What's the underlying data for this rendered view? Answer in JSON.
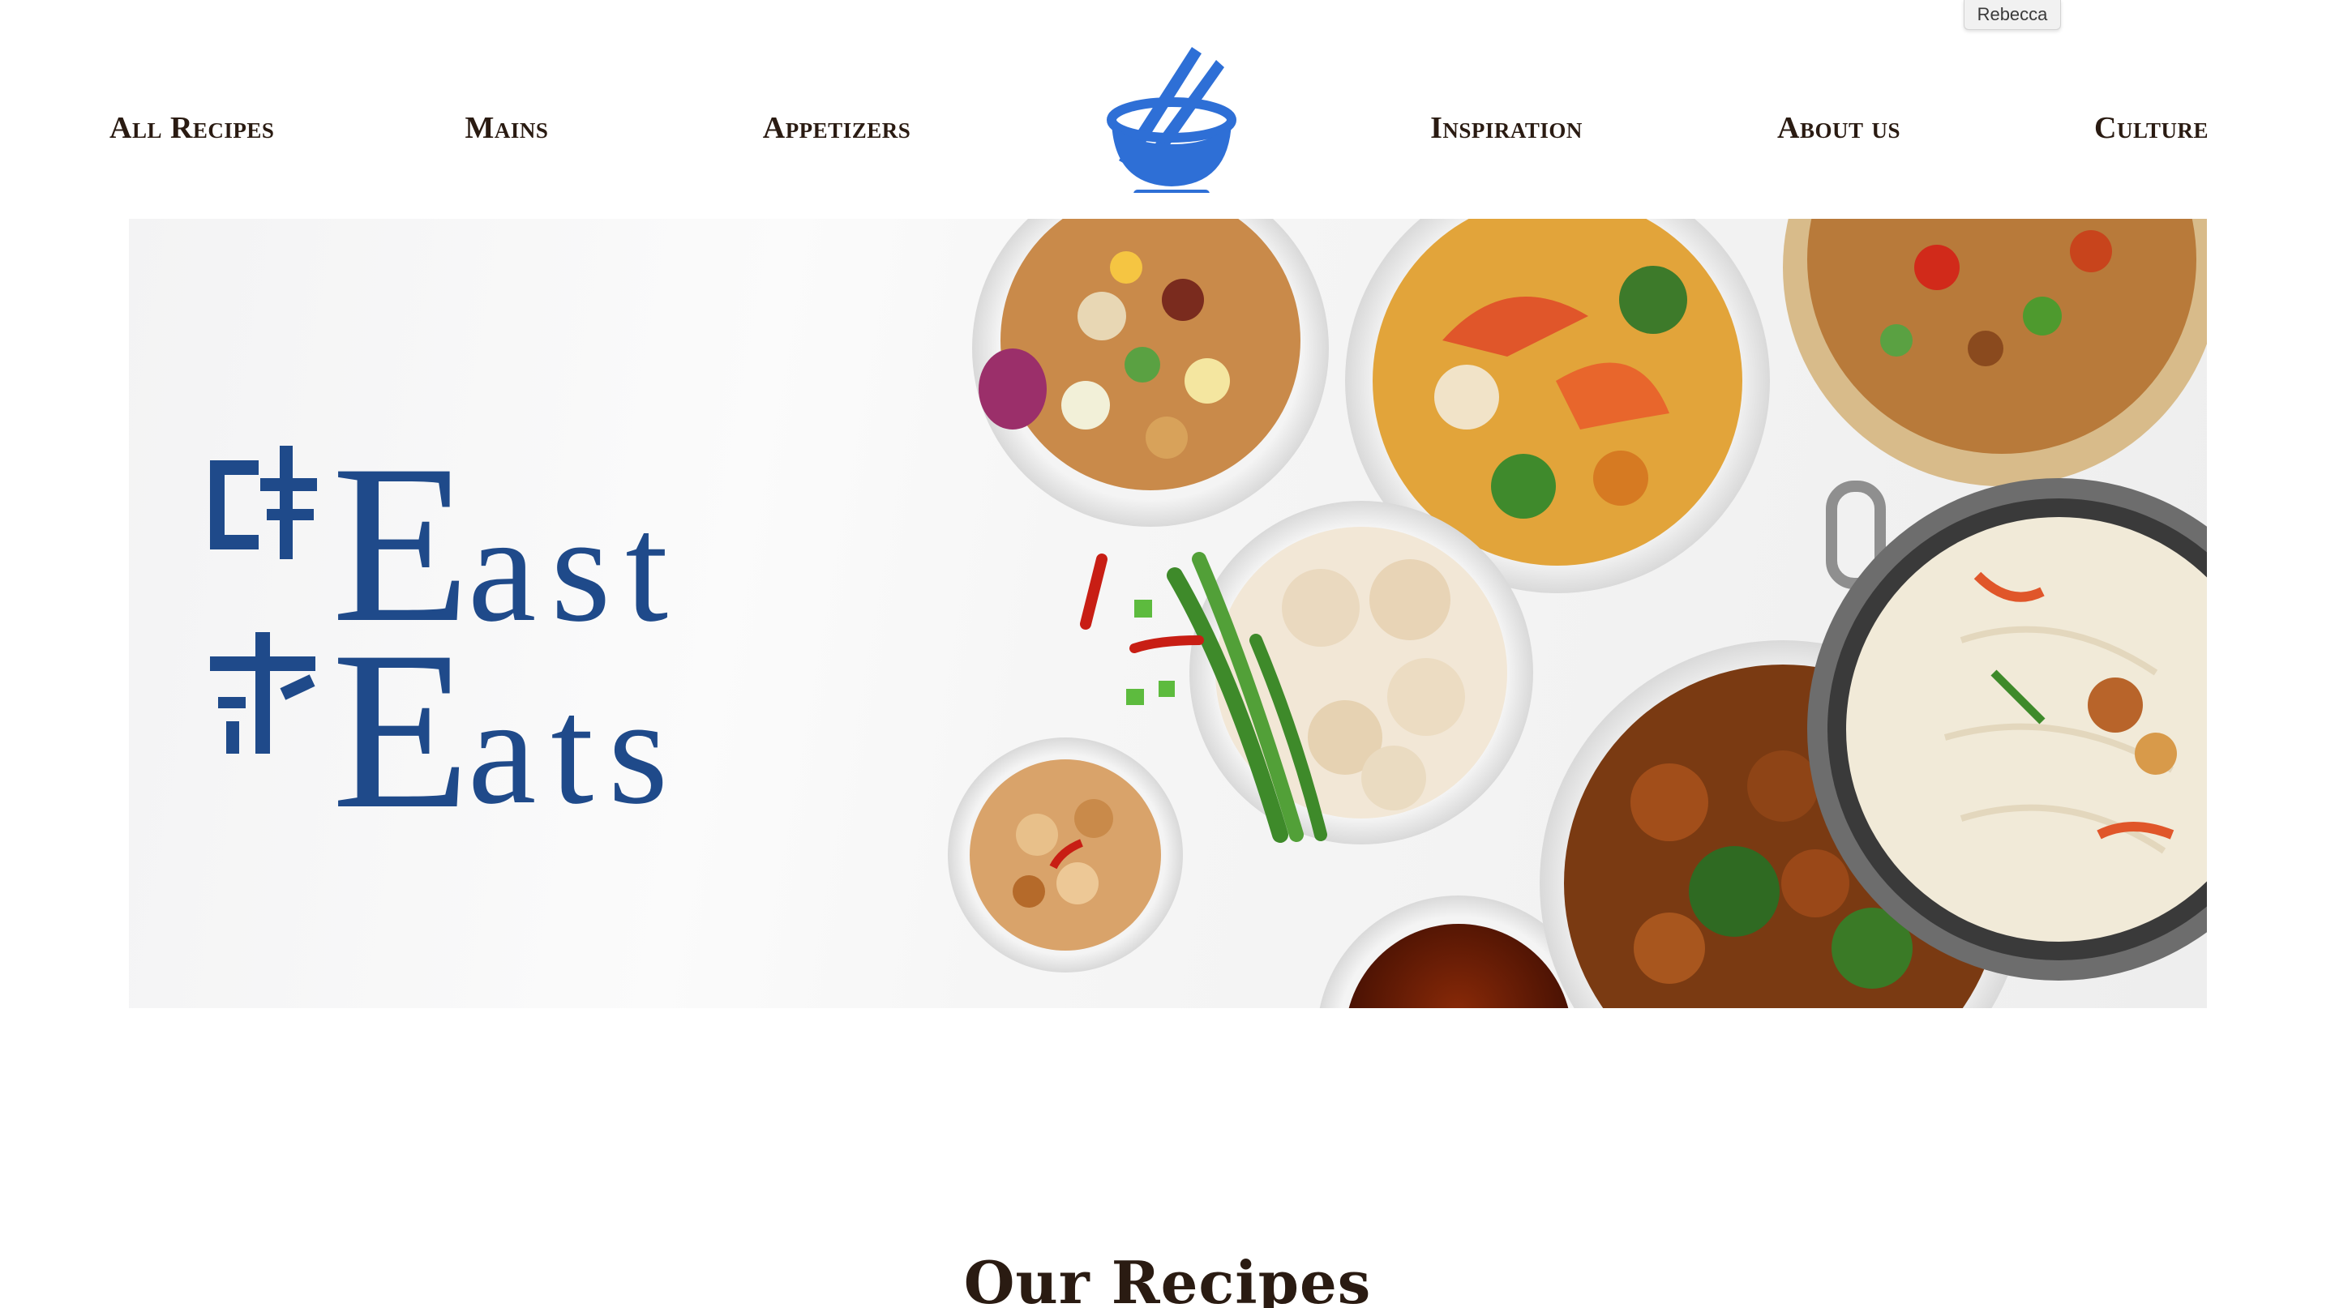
{
  "user": {
    "name": "Rebecca"
  },
  "nav": {
    "left": [
      "All Recipes",
      "Mains",
      "Appetizers"
    ],
    "right": [
      "Inspiration",
      "About us",
      "Culture"
    ]
  },
  "logo": {
    "icon": "bowl-chopsticks-icon",
    "color": "#2e6fd6"
  },
  "hero": {
    "title_line1": "East",
    "title_line2": "Eats",
    "side_glyphs": "华味",
    "title_color": "#1f4a8a"
  },
  "sections": {
    "recipes_heading": "Our Recipes"
  }
}
